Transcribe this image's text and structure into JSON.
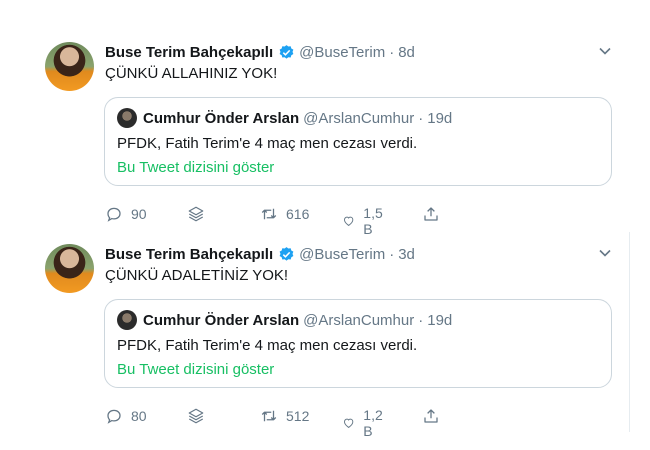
{
  "tweets": [
    {
      "author_name": "Buse Terim Bahçekapılı",
      "author_handle": "@BuseTerim",
      "separator": "·",
      "age": "8d",
      "text": "ÇÜNKÜ ALLAHINIZ YOK!",
      "quoted": {
        "author_name": "Cumhur Önder Arslan",
        "author_handle": "@ArslanCumhur",
        "separator": "·",
        "age": "19d",
        "text": "PFDK, Fatih Terim'e 4 maç men cezası verdi.",
        "thread_link": "Bu Tweet dizisini göster"
      },
      "replies": "90",
      "retweets": "616",
      "likes": "1,5 B"
    },
    {
      "author_name": "Buse Terim Bahçekapılı",
      "author_handle": "@BuseTerim",
      "separator": "·",
      "age": "3d",
      "text": "ÇÜNKÜ ADALETİNİZ YOK!",
      "quoted": {
        "author_name": "Cumhur Önder Arslan",
        "author_handle": "@ArslanCumhur",
        "separator": "·",
        "age": "19d",
        "text": "PFDK, Fatih Terim'e 4 maç men cezası verdi.",
        "thread_link": "Bu Tweet dizisini göster"
      },
      "replies": "80",
      "retweets": "512",
      "likes": "1,2 B"
    }
  ],
  "colors": {
    "verified": "#1da1f2",
    "link": "#17bf63",
    "muted": "#657786",
    "border": "#ccd6dd"
  },
  "icons": [
    "verified-badge-icon",
    "chevron-down-icon",
    "reply-icon",
    "layers-icon",
    "retweet-icon",
    "like-icon",
    "share-icon"
  ]
}
